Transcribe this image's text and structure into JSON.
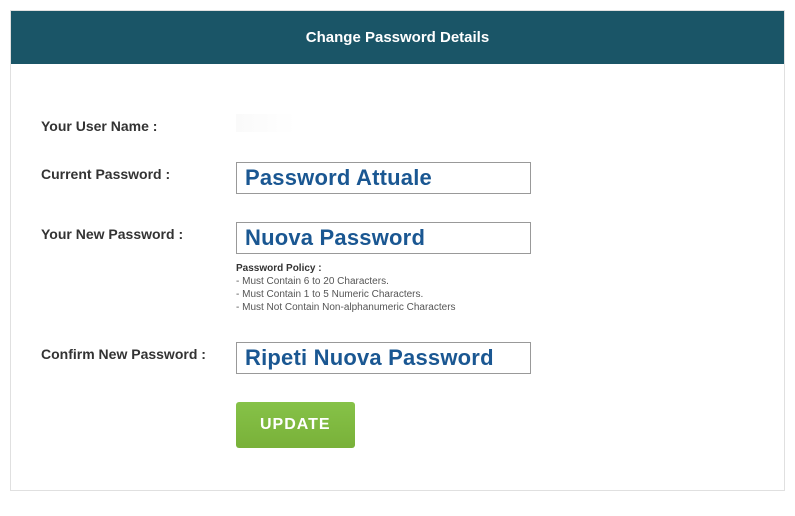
{
  "header": {
    "title": "Change Password Details"
  },
  "form": {
    "username_label": "Your User Name :",
    "username_value": "",
    "current_pw_label": "Current Password :",
    "current_pw_overlay": "Password Attuale",
    "new_pw_label": "Your New Password :",
    "new_pw_overlay": "Nuova Password",
    "confirm_pw_label": "Confirm New Password :",
    "confirm_pw_overlay": "Ripeti Nuova Password",
    "policy_title": "Password Policy :",
    "policy_line1": "- Must Contain 6 to 20 Characters.",
    "policy_line2": "- Must Contain 1 to 5 Numeric Characters.",
    "policy_line3": "- Must Not Contain Non-alphanumeric Characters",
    "update_button": "UPDATE"
  }
}
